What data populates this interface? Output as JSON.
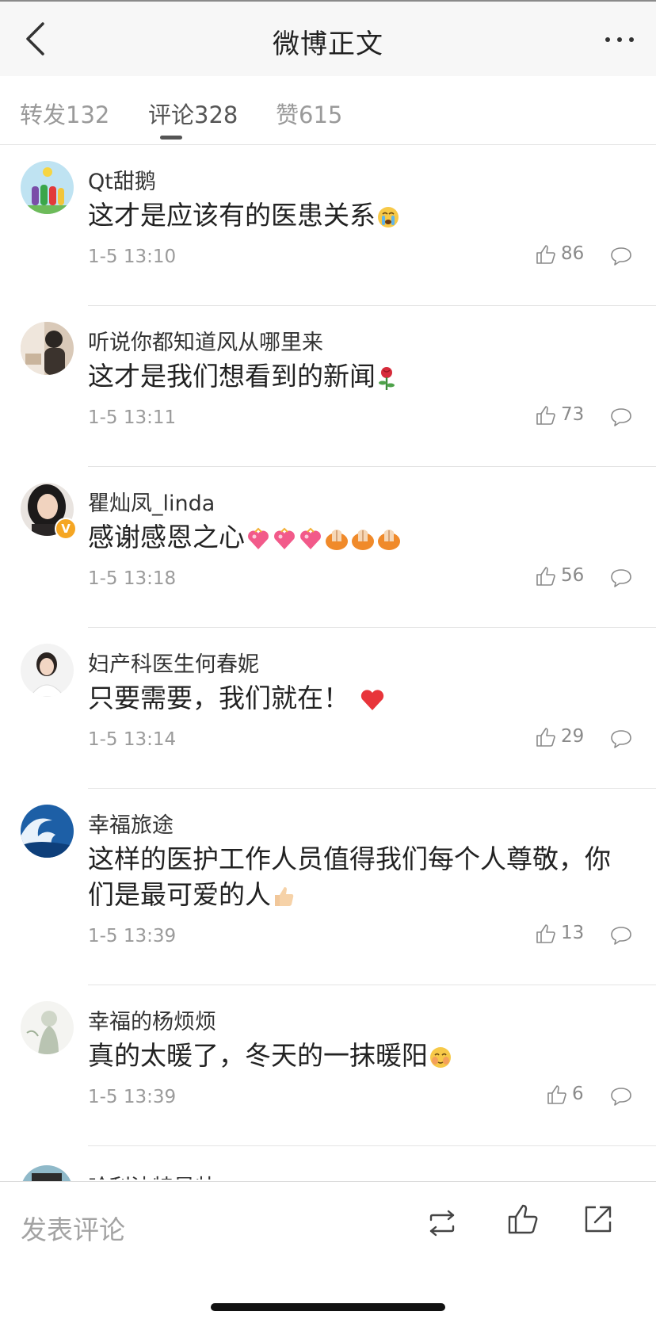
{
  "header": {
    "title": "微博正文"
  },
  "tabs": [
    {
      "label": "转发132"
    },
    {
      "label": "评论328"
    },
    {
      "label": "赞615"
    }
  ],
  "comments": [
    {
      "user": "Qt甜鹅",
      "text": "这才是应该有的医患关系",
      "time": "1-5 13:10",
      "likes": "86"
    },
    {
      "user": "听说你都知道风从哪里来",
      "text": "这才是我们想看到的新闻",
      "time": "1-5 13:11",
      "likes": "73"
    },
    {
      "user": "瞿灿凤_linda",
      "text": "感谢感恩之心",
      "time": "1-5 13:18",
      "likes": "56",
      "verified": "V"
    },
    {
      "user": "妇产科医生何春妮",
      "text": "只要需要，我们就在！",
      "time": "1-5 13:14",
      "likes": "29"
    },
    {
      "user": "幸福旅途",
      "text": "这样的医护工作人员值得我们每个人尊敬，你们是最可爱的人",
      "time": "1-5 13:39",
      "likes": "13"
    },
    {
      "user": "幸福的杨烦烦",
      "text": "真的太暖了，冬天的一抹暖阳",
      "time": "1-5 13:39",
      "likes": "6"
    }
  ],
  "partial_comment": {
    "user": "哈利波特是帅"
  },
  "bottom_bar": {
    "placeholder": "发表评论"
  },
  "colors": {
    "accent_text": "#333333",
    "muted": "#9b9b9b",
    "heart": "#e8343a"
  },
  "icons": [
    "back-icon",
    "more-icon",
    "like-icon",
    "comment-icon",
    "repost-icon",
    "share-icon"
  ]
}
